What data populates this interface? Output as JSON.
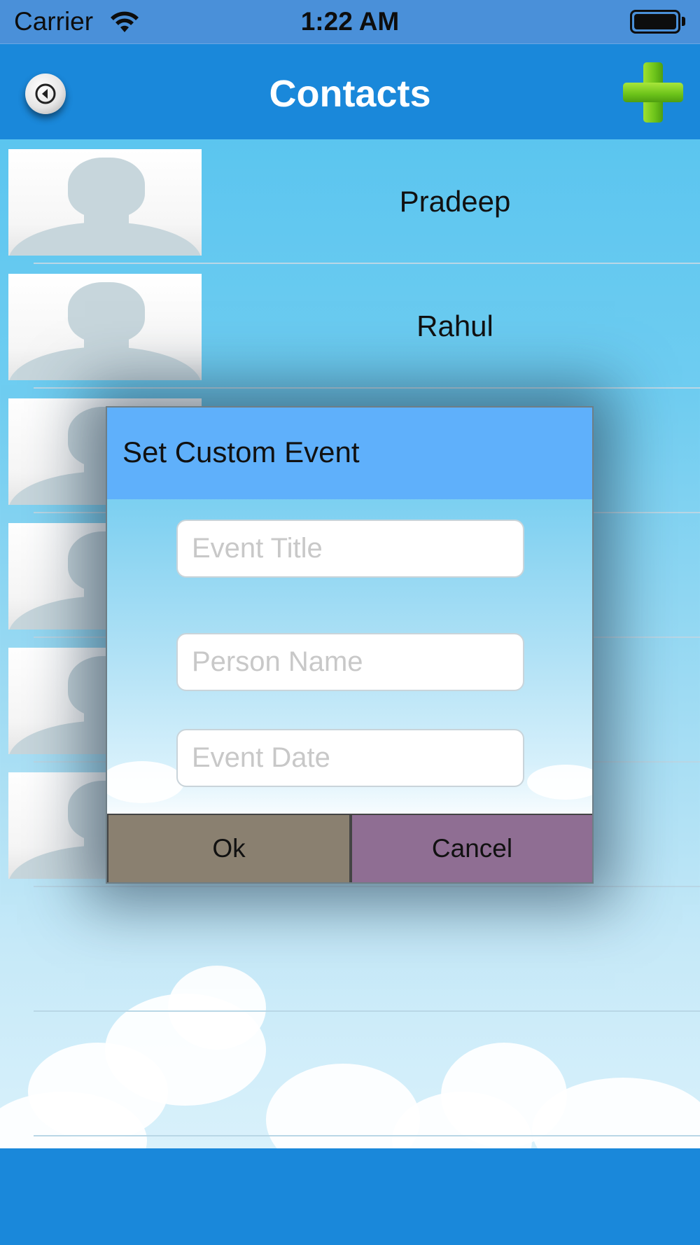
{
  "status_bar": {
    "carrier": "Carrier",
    "time": "1:22 AM"
  },
  "nav": {
    "title": "Contacts",
    "back_icon": "back-arrow-circle-icon",
    "add_icon": "plus-icon"
  },
  "contacts": [
    {
      "name": "Pradeep"
    },
    {
      "name": "Rahul"
    },
    {
      "name": ""
    },
    {
      "name": ""
    },
    {
      "name": ""
    },
    {
      "name": ""
    }
  ],
  "dialog": {
    "title": "Set Custom Event",
    "fields": {
      "event_title": {
        "value": "",
        "placeholder": "Event Title"
      },
      "person_name": {
        "value": "",
        "placeholder": "Person Name"
      },
      "event_date": {
        "value": "",
        "placeholder": "Event Date"
      }
    },
    "ok_label": "Ok",
    "cancel_label": "Cancel"
  },
  "colors": {
    "nav_bar": "#1a88da",
    "dialog_header": "#5fb0fb",
    "ok_button": "#8a8070",
    "cancel_button": "#8f6e93",
    "add_icon": "#7ccc22"
  }
}
